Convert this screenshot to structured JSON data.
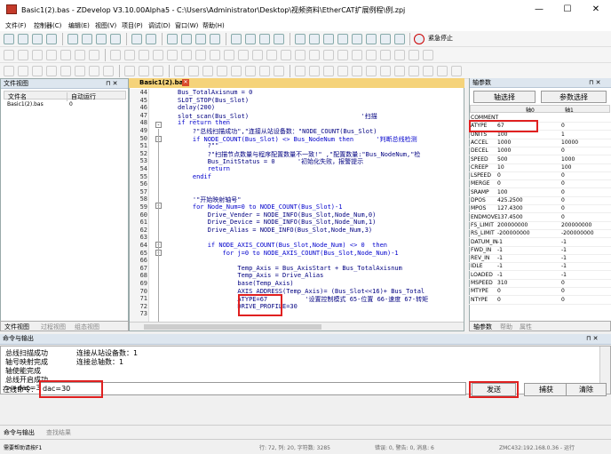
{
  "window": {
    "title": "Basic1(2).bas - ZDevelop V3.10.00Alpha5 - C:\\Users\\Administrator\\Desktop\\视频资料\\EtherCAT扩展例程\\例.zpj",
    "min": "—",
    "max": "☐",
    "close": "✕"
  },
  "menu": [
    "文件(F)",
    "控制器(C)",
    "编辑(E)",
    "视图(V)",
    "项目(P)",
    "调试(D)",
    "窗口(W)",
    "帮助(H)"
  ],
  "toolbar": {
    "emergency_stop": "紧急停止"
  },
  "file_view": {
    "title": "文件视图",
    "pin": "⊓ ✕",
    "columns": [
      "文件名",
      "自动运行"
    ],
    "rows": [
      {
        "name": "Basic1(2).bas",
        "auto": "0"
      }
    ],
    "tabs": [
      "文件视图",
      "过程视图",
      "组态视图"
    ]
  },
  "editor": {
    "tab": "Basic1(2).bas",
    "lines": [
      {
        "n": "44",
        "t": "Bus_TotalAxisnum = 0"
      },
      {
        "n": "45",
        "t": "SLOT_STOP(Bus_Slot)"
      },
      {
        "n": "46",
        "t": "delay(200)"
      },
      {
        "n": "47",
        "t": "slot_scan(Bus_Slot)                              '扫描"
      },
      {
        "n": "48",
        "t": "if return then"
      },
      {
        "n": "49",
        "t": "    ?\"总线扫描成功\",\"连接从站设备数：\"NODE_COUNT(Bus_Slot)"
      },
      {
        "n": "50",
        "t": "    if NODE_COUNT(Bus_Slot) <> Bus_NodeNum then      '判断总线检测"
      },
      {
        "n": "51",
        "t": "        ?\"\""
      },
      {
        "n": "52",
        "t": "        ?\"扫描节点数量与程序配置数量不一致!\" ,\"配置数量:\"Bus_NodeNum,\"检"
      },
      {
        "n": "53",
        "t": "        Bus_InitStatus = 0      '初始化失败，报警提示"
      },
      {
        "n": "54",
        "t": "        return"
      },
      {
        "n": "55",
        "t": "    endif"
      },
      {
        "n": "56",
        "t": ""
      },
      {
        "n": "57",
        "t": ""
      },
      {
        "n": "58",
        "t": "    '\"开始映射轴号\""
      },
      {
        "n": "59",
        "t": "    for Node_Num=0 to NODE_COUNT(Bus_Slot)-1"
      },
      {
        "n": "60",
        "t": "        Drive_Vender = NODE_INFO(Bus_Slot,Node_Num,0)"
      },
      {
        "n": "61",
        "t": "        Drive_Device = NODE_INFO(Bus_Slot,Node_Num,1)"
      },
      {
        "n": "62",
        "t": "        Drive_Alias = NODE_INFO(Bus_Slot,Node_Num,3)"
      },
      {
        "n": "63",
        "t": ""
      },
      {
        "n": "64",
        "t": "        if NODE_AXIS_COUNT(Bus_Slot,Node_Num) <> 0  then"
      },
      {
        "n": "65",
        "t": "            for j=0 to NODE_AXIS_COUNT(Bus_Slot,Node_Num)-1"
      },
      {
        "n": "66",
        "t": ""
      },
      {
        "n": "67",
        "t": "                Temp_Axis = Bus_AxisStart + Bus_TotalAxisnum"
      },
      {
        "n": "68",
        "t": "                Temp_Axis = Drive_Alias"
      },
      {
        "n": "69",
        "t": "                base(Temp_Axis)"
      },
      {
        "n": "70",
        "t": "                AXIS_ADDRESS(Temp_Axis)= (Bus_Slot<<16)+ Bus_Total"
      },
      {
        "n": "71",
        "t": "                ATYPE=67          '设置控制模式 65-位置 66-速度 67-转矩"
      },
      {
        "n": "72",
        "t": "                DRIVE_PROFILE=30"
      },
      {
        "n": "73",
        "t": ""
      }
    ]
  },
  "axis_params": {
    "title": "轴参数",
    "pin": "⊓ ✕",
    "buttons": [
      "轴选择",
      "参数选择"
    ],
    "columns": [
      "",
      "轴0",
      "轴1"
    ],
    "rows": [
      {
        "k": "COMMENT",
        "a": "",
        "b": ""
      },
      {
        "k": "ATYPE",
        "a": "67",
        "b": "0"
      },
      {
        "k": "UNITS",
        "a": "100",
        "b": "1"
      },
      {
        "k": "ACCEL",
        "a": "1000",
        "b": "10000"
      },
      {
        "k": "DECEL",
        "a": "1000",
        "b": "0"
      },
      {
        "k": "SPEED",
        "a": "500",
        "b": "1000"
      },
      {
        "k": "CREEP",
        "a": "10",
        "b": "100"
      },
      {
        "k": "LSPEED",
        "a": "0",
        "b": "0"
      },
      {
        "k": "MERGE",
        "a": "0",
        "b": "0"
      },
      {
        "k": "SRAMP",
        "a": "100",
        "b": "0"
      },
      {
        "k": "DPOS",
        "a": "425.2500",
        "b": "0"
      },
      {
        "k": "MPOS",
        "a": "127.4300",
        "b": "0"
      },
      {
        "k": "ENDMOVE",
        "a": "137.4500",
        "b": "0"
      },
      {
        "k": "FS_LIMIT",
        "a": "200000000",
        "b": "200000000"
      },
      {
        "k": "RS_LIMIT",
        "a": "-200000000",
        "b": "-200000000"
      },
      {
        "k": "DATUM_IN",
        "a": "-1",
        "b": "-1"
      },
      {
        "k": "FWD_IN",
        "a": "-1",
        "b": "-1"
      },
      {
        "k": "REV_IN",
        "a": "-1",
        "b": "-1"
      },
      {
        "k": "IDLE",
        "a": "-1",
        "b": "-1"
      },
      {
        "k": "LOADED",
        "a": "-1",
        "b": "-1"
      },
      {
        "k": "MSPEED",
        "a": "310",
        "b": "0"
      },
      {
        "k": "MTYPE",
        "a": "0",
        "b": "0"
      },
      {
        "k": "NTYPE",
        "a": "0",
        "b": "0"
      }
    ],
    "tabs": [
      "轴参数",
      "帮助",
      "属性"
    ]
  },
  "command": {
    "title": "命令与输出",
    "pin": "⊓ ✕",
    "output": [
      {
        "a": "总线扫描成功",
        "b": "连接从站设备数：1"
      },
      {
        "a": "轴号映射完成",
        "b": "连接总轴数：1"
      },
      {
        "a": "轴使能完成",
        "b": ""
      },
      {
        "a": "总线开启成功",
        "b": ""
      },
      {
        "a": ">>dac=30",
        "b": ""
      }
    ],
    "input_label": "在线命令:",
    "input_value": "dac=30",
    "send": "发送",
    "capture": "捕获",
    "clear": "清除",
    "tabs": [
      "命令与输出",
      "查找结果"
    ]
  },
  "status": {
    "help": "需要帮助请按F1",
    "pos": "行: 72, 列: 20, 字符数: 3285",
    "errors": "错误: 0, 警告: 0, 消息: 6",
    "conn": "ZMC432:192.168.0.36 - 运行"
  }
}
